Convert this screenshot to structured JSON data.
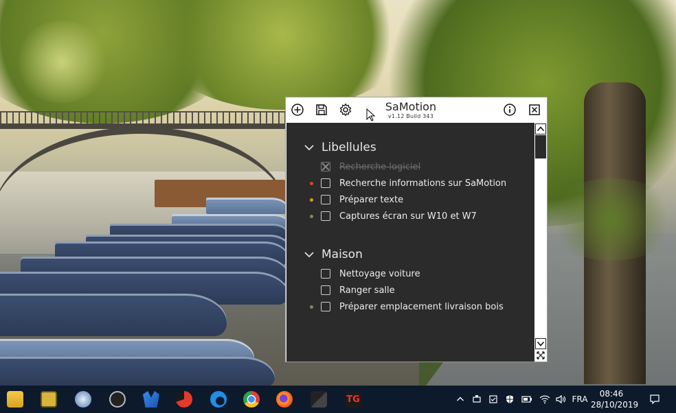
{
  "window": {
    "title": "SaMotion",
    "build": "v1.12 Build 343",
    "toolbar": {
      "add_icon": "plus-circle-icon",
      "save_icon": "floppy-disk-icon",
      "settings_icon": "gear-icon"
    },
    "info_icon": "info-circle-icon",
    "close_icon": "close-box-icon"
  },
  "groups": [
    {
      "name": "Libellules",
      "expanded": true,
      "tasks": [
        {
          "label": "Recherche logiciel",
          "done": true,
          "priority_color": ""
        },
        {
          "label": "Recherche informations sur SaMotion",
          "done": false,
          "priority_color": "#d9452c"
        },
        {
          "label": "Préparer texte",
          "done": false,
          "priority_color": "#d99a22"
        },
        {
          "label": "Captures écran sur W10 et W7",
          "done": false,
          "priority_color": "#8a8a4a"
        }
      ]
    },
    {
      "name": "Maison",
      "expanded": true,
      "tasks": [
        {
          "label": "Nettoyage voiture",
          "done": false,
          "priority_color": ""
        },
        {
          "label": "Ranger salle",
          "done": false,
          "priority_color": ""
        },
        {
          "label": "Préparer emplacement livraison bois",
          "done": false,
          "priority_color": "#8a8a4a"
        }
      ]
    }
  ],
  "taskbar": {
    "apps": [
      "file-explorer-icon",
      "sticky-app-icon",
      "network-app-icon",
      "speedometer-app-icon",
      "malwarebytes-icon",
      "ccleaner-icon",
      "edge-icon",
      "chrome-icon",
      "firefox-icon",
      "terminal-app-icon",
      "tg-app-icon"
    ],
    "tray": {
      "language": "FRA",
      "time": "08:46",
      "date": "28/10/2019"
    }
  }
}
